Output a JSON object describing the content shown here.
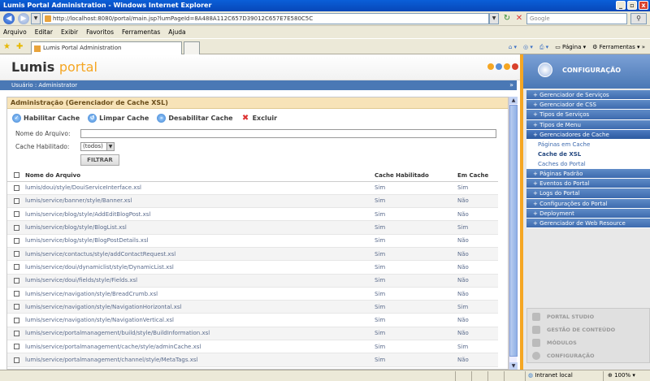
{
  "window": {
    "title": "Lumis Portal Administration - Windows Internet Explorer"
  },
  "address": {
    "url": "http://localhost:8080/portal/main.jsp?lumPageId=8A488A112C657D39012C657E7E580C5C",
    "search_placeholder": "Google"
  },
  "menubar": [
    "Arquivo",
    "Editar",
    "Exibir",
    "Favoritos",
    "Ferramentas",
    "Ajuda"
  ],
  "tab": {
    "label": "Lumis Portal Administration"
  },
  "cmdbar": {
    "pagina": "Página",
    "ferramentas": "Ferramentas"
  },
  "header": {
    "logo_main": "Lumis",
    "logo_sub": "portal",
    "usuario": "Usuário : Administrator",
    "right_title": "CONFIGURAÇÃO"
  },
  "content": {
    "title": "Administração (Gerenciador de Cache XSL)",
    "toolbar": {
      "habilitar": "Habilitar Cache",
      "limpar": "Limpar Cache",
      "desabilitar": "Desabilitar Cache",
      "excluir": "Excluir"
    },
    "form": {
      "nome_label": "Nome do Arquivo:",
      "cache_label": "Cache Habilitado:",
      "cache_value": "(todos)",
      "filtrar": "FILTRAR"
    },
    "table": {
      "headers": [
        "Nome do Arquivo",
        "Cache Habilitado",
        "Em Cache"
      ],
      "rows": [
        [
          "lumis/doui/style/DouiServiceInterface.xsl",
          "Sim",
          "Sim"
        ],
        [
          "lumis/service/banner/style/Banner.xsl",
          "Sim",
          "Não"
        ],
        [
          "lumis/service/blog/style/AddEditBlogPost.xsl",
          "Sim",
          "Não"
        ],
        [
          "lumis/service/blog/style/BlogList.xsl",
          "Sim",
          "Sim"
        ],
        [
          "lumis/service/blog/style/BlogPostDetails.xsl",
          "Sim",
          "Não"
        ],
        [
          "lumis/service/contactus/style/addContactRequest.xsl",
          "Sim",
          "Não"
        ],
        [
          "lumis/service/doui/dynamiclist/style/DynamicList.xsl",
          "Sim",
          "Não"
        ],
        [
          "lumis/service/doui/fields/style/Fields.xsl",
          "Sim",
          "Não"
        ],
        [
          "lumis/service/navigation/style/BreadCrumb.xsl",
          "Sim",
          "Não"
        ],
        [
          "lumis/service/navigation/style/NavigationHorizontal.xsl",
          "Sim",
          "Sim"
        ],
        [
          "lumis/service/navigation/style/NavigationVertical.xsl",
          "Sim",
          "Não"
        ],
        [
          "lumis/service/portalmanagement/build/style/BuildInformation.xsl",
          "Sim",
          "Não"
        ],
        [
          "lumis/service/portalmanagement/cache/style/adminCache.xsl",
          "Sim",
          "Sim"
        ],
        [
          "lumis/service/portalmanagement/channel/style/MetaTags.xsl",
          "Sim",
          "Não"
        ]
      ]
    }
  },
  "sidebar": {
    "items_top": [
      "+ Gerenciador de Serviços",
      "+ Gerenciador de CSS",
      "+ Tipos de Serviços",
      "+ Tipos de Menu"
    ],
    "expanded": "+ Gerenciadores de Cache",
    "subitems": [
      "Páginas em Cache",
      "Cache de XSL",
      "Caches do Portal"
    ],
    "items_bottom": [
      "+ Páginas Padrão",
      "+ Eventos do Portal",
      "+ Logs do Portal",
      "+ Configurações do Portal",
      "+ Deployment",
      "+ Gerenciador de Web Resource"
    ],
    "bottom_panel": [
      "PORTAL STUDIO",
      "GESTÃO DE CONTEÚDO",
      "MÓDULOS",
      "CONFIGURAÇÃO"
    ]
  },
  "statusbar": {
    "zone": "Intranet local",
    "zoom": "100%"
  }
}
